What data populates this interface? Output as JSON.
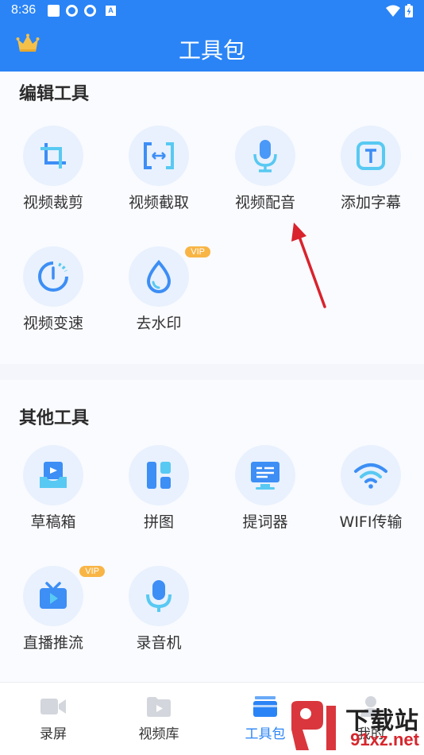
{
  "status_bar": {
    "time": "8:36"
  },
  "header": {
    "title": "工具包"
  },
  "sections": [
    {
      "title": "编辑工具",
      "tools": [
        {
          "label": "视频裁剪",
          "icon": "crop-icon",
          "vip": false
        },
        {
          "label": "视频截取",
          "icon": "trim-icon",
          "vip": false
        },
        {
          "label": "视频配音",
          "icon": "microphone-icon",
          "vip": false
        },
        {
          "label": "添加字幕",
          "icon": "subtitle-icon",
          "vip": false
        },
        {
          "label": "视频变速",
          "icon": "speed-icon",
          "vip": false
        },
        {
          "label": "去水印",
          "icon": "water-drop-icon",
          "vip": true,
          "vip_text": "VIP"
        }
      ]
    },
    {
      "title": "其他工具",
      "tools": [
        {
          "label": "草稿箱",
          "icon": "draft-icon",
          "vip": false
        },
        {
          "label": "拼图",
          "icon": "collage-icon",
          "vip": false
        },
        {
          "label": "提词器",
          "icon": "teleprompter-icon",
          "vip": false
        },
        {
          "label": "WIFI传输",
          "icon": "wifi-icon",
          "vip": false
        },
        {
          "label": "直播推流",
          "icon": "live-tv-icon",
          "vip": true,
          "vip_text": "VIP"
        },
        {
          "label": "录音机",
          "icon": "recorder-mic-icon",
          "vip": false
        }
      ]
    }
  ],
  "bottom_nav": [
    {
      "label": "录屏",
      "icon": "record-screen-icon",
      "active": false
    },
    {
      "label": "视频库",
      "icon": "video-library-icon",
      "active": false
    },
    {
      "label": "工具包",
      "icon": "toolbox-icon",
      "active": true
    },
    {
      "label": "我的",
      "icon": "profile-icon",
      "active": false
    }
  ],
  "watermark": {
    "text": "下载站",
    "domain": "91xz.net"
  },
  "colors": {
    "primary": "#2a84f6",
    "vip": "#f8b545",
    "icon_bg": "#e8f1fd",
    "annotation_arrow": "#d9232d"
  }
}
